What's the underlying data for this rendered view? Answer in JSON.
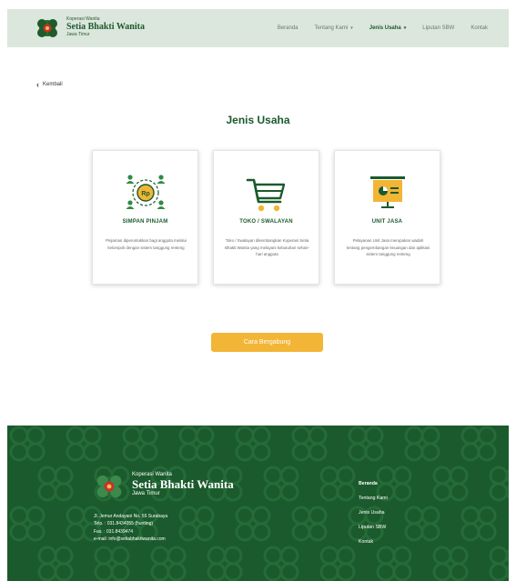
{
  "header": {
    "brand_pre": "Koperasi Wanita",
    "brand_name": "Setia Bhakti Wanita",
    "brand_sub": "Jawa Timur",
    "nav": [
      {
        "label": "Beranda",
        "dropdown": false
      },
      {
        "label": "Tentang Kami",
        "dropdown": true
      },
      {
        "label": "Jenis Usaha",
        "dropdown": true,
        "active": true
      },
      {
        "label": "Liputan SBW",
        "dropdown": false
      },
      {
        "label": "Kontak",
        "dropdown": false
      }
    ]
  },
  "back_label": "Kembali",
  "page_title": "Jenis Usaha",
  "cards": [
    {
      "icon": "money-people-icon",
      "title": "SIMPAN PINJAM",
      "desc": "Pinjaman diperuntukkan bagi anggota melalui kelompok dengan sistem tanggung renteng"
    },
    {
      "icon": "shopping-cart-icon",
      "title": "TOKO / SWALAYAN",
      "desc": "Toko / Swalayan dikembangkan Koperasi Setia Bhakti Wanita yang melayani kebutuhan sehari-hari anggota"
    },
    {
      "icon": "presentation-board-icon",
      "title": "UNIT JASA",
      "desc": "Pelayanan Unit Jasa merupakan wadah tentang pengembangan keuangan dan aplikasi sistem tanggung renteng"
    }
  ],
  "cta_label": "Cara Bergabung",
  "footer": {
    "brand_pre": "Koperasi Wanita",
    "brand_name": "Setia Bhakti Wanita",
    "brand_sub": "Jawa Timur",
    "address": "Jl. Jemur Andayani No. 55 Surabaya",
    "phone": "Telp. : 031.8434055 (hunting)",
    "fax": "Fax. : 031.8439474",
    "email": "e-mail: info@setiabhaktiwanita.com",
    "links": [
      "Beranda",
      "Tentang Kami",
      "Jenis Usaha",
      "Liputan SBW",
      "Kontak"
    ]
  },
  "colors": {
    "primary_green": "#1b5a2c",
    "header_bg": "#dbe6dd",
    "accent_yellow": "#f3b535"
  }
}
